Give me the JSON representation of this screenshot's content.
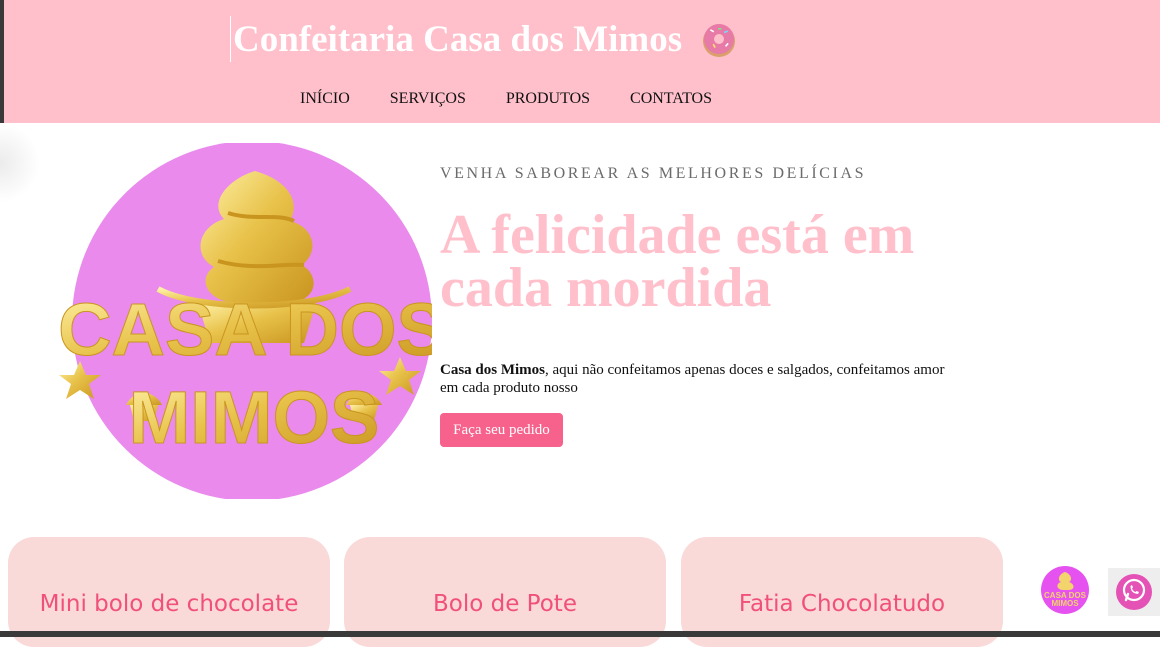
{
  "header": {
    "title": "Confeitaria Casa dos Mimos",
    "icon": "donut-icon",
    "background": "#ffc0cb"
  },
  "nav": {
    "items": [
      "INÍCIO",
      "SERVIÇOS",
      "PRODUTOS",
      "CONTATOS"
    ]
  },
  "hero": {
    "logo_line1": "CASA DOS",
    "logo_line2": "MIMOS",
    "eyebrow": "VENHA SABOREAR AS MELHORES DELÍCIAS",
    "headline": "A felicidade está em cada mordida",
    "description_bold": "Casa dos Mimos",
    "description_rest": ", aqui não confeitamos apenas doces e salgados, confeitamos amor em cada produto nosso",
    "button_label": "Faça seu pedido"
  },
  "products": [
    {
      "title": "Mini bolo de chocolate"
    },
    {
      "title": "Bolo de Pote"
    },
    {
      "title": "Fatia Chocolatudo"
    }
  ],
  "floating": {
    "mini_logo_text1": "CASA DOS",
    "mini_logo_text2": "MIMOS",
    "whatsapp_icon": "whatsapp-icon"
  },
  "colors": {
    "accent_pink": "#ffc0cb",
    "button_pink": "#f6628b",
    "card_bg": "#fad9d9",
    "card_title": "#f0507a",
    "logo_circle": "#e98aec",
    "gold": "#e8c24a"
  }
}
